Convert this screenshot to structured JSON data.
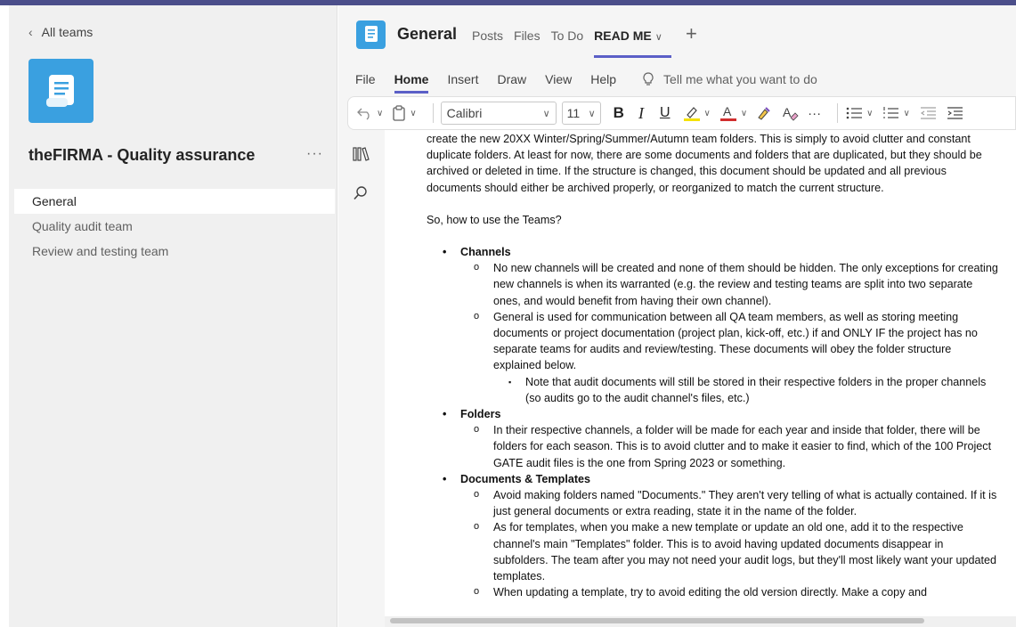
{
  "sidebar": {
    "back_label": "All teams",
    "team_name": "theFIRMA - Quality assurance",
    "more_label": "···",
    "channels": [
      {
        "label": "General",
        "active": true
      },
      {
        "label": "Quality audit team",
        "active": false
      },
      {
        "label": "Review and testing team",
        "active": false
      }
    ]
  },
  "header": {
    "channel_title": "General",
    "tabs": [
      "Posts",
      "Files",
      "To Do",
      "READ ME"
    ],
    "active_tab": "READ ME",
    "add_tab": "+"
  },
  "ribbon": {
    "menu": [
      "File",
      "Home",
      "Insert",
      "Draw",
      "View",
      "Help"
    ],
    "active_menu": "Home",
    "tell_me": "Tell me what you want to do"
  },
  "toolbar": {
    "font": "Calibri",
    "size": "11",
    "bold": "B",
    "italic": "I",
    "underline": "U",
    "more": "···"
  },
  "document": {
    "intro": "create the new 20XX Winter/Spring/Summer/Autumn team folders. This is simply to avoid clutter and constant duplicate folders. At least for now, there are some documents and folders that are duplicated, but they should be archived or deleted in time. If the structure is changed, this document should be updated and all previous documents should either be archived properly, or reorganized to match the current structure.",
    "question": "So, how to use the Teams?",
    "sections": [
      {
        "heading": "Channels",
        "items": [
          "No new channels will be created and none of them should be hidden. The only exceptions for creating new channels is when its warranted (e.g. the review and testing teams are split into two separate ones, and would benefit from having their own channel).",
          "General is used for communication between all QA team members, as well as storing meeting documents or project documentation (project plan, kick-off, etc.) if and ONLY IF the project has no separate teams for audits and review/testing. These documents will obey the folder structure explained below."
        ],
        "subitem": "Note that audit documents will still be stored in their respective folders in the proper channels (so audits go to the audit channel's files, etc.)"
      },
      {
        "heading": "Folders",
        "items": [
          "In their respective channels, a folder will be made for each year and inside that folder, there will be folders for each season. This is to avoid clutter and to make it easier to find, which of the 100 Project GATE audit files is the one from Spring 2023 or something."
        ]
      },
      {
        "heading": "Documents & Templates",
        "items": [
          "Avoid making folders named \"Documents.\" They aren't very telling of what is actually contained. If it is just general documents or extra reading, state it in the name of the folder.",
          "As for templates, when you make a new template or update an old one, add it to the respective channel's main \"Templates\" folder. This is to avoid having updated documents disappear in subfolders. The team after you may not need your audit logs, but they'll most likely want your updated templates.",
          "When updating a template, try to avoid editing the old version directly. Make a copy and"
        ]
      }
    ]
  },
  "colors": {
    "accent": "#5b5fc7",
    "team_icon": "#3aa0e0",
    "top_bar": "#4b4e8a"
  }
}
